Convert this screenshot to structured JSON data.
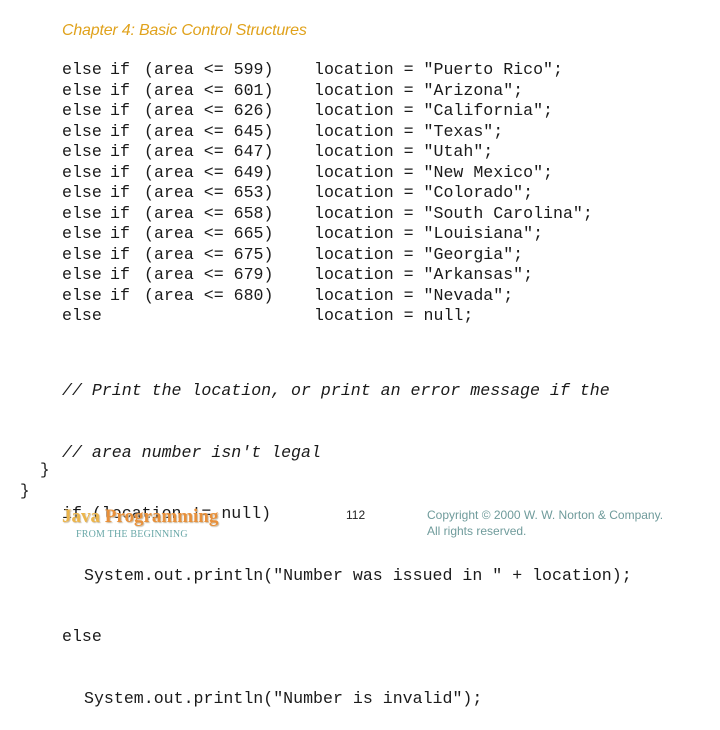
{
  "header": {
    "title": "Chapter 4: Basic Control Structures"
  },
  "code_table": {
    "rows": [
      {
        "kw1": "else",
        "kw2": "if",
        "cond": "(area <= 599)",
        "stmt": "location = \"Puerto Rico\";"
      },
      {
        "kw1": "else",
        "kw2": "if",
        "cond": "(area <= 601)",
        "stmt": "location = \"Arizona\";"
      },
      {
        "kw1": "else",
        "kw2": "if",
        "cond": "(area <= 626)",
        "stmt": "location = \"California\";"
      },
      {
        "kw1": "else",
        "kw2": "if",
        "cond": "(area <= 645)",
        "stmt": "location = \"Texas\";"
      },
      {
        "kw1": "else",
        "kw2": "if",
        "cond": "(area <= 647)",
        "stmt": "location = \"Utah\";"
      },
      {
        "kw1": "else",
        "kw2": "if",
        "cond": "(area <= 649)",
        "stmt": "location = \"New Mexico\";"
      },
      {
        "kw1": "else",
        "kw2": "if",
        "cond": "(area <= 653)",
        "stmt": "location = \"Colorado\";"
      },
      {
        "kw1": "else",
        "kw2": "if",
        "cond": "(area <= 658)",
        "stmt": "location = \"South Carolina\";"
      },
      {
        "kw1": "else",
        "kw2": "if",
        "cond": "(area <= 665)",
        "stmt": "location = \"Louisiana\";"
      },
      {
        "kw1": "else",
        "kw2": "if",
        "cond": "(area <= 675)",
        "stmt": "location = \"Georgia\";"
      },
      {
        "kw1": "else",
        "kw2": "if",
        "cond": "(area <= 679)",
        "stmt": "location = \"Arkansas\";"
      },
      {
        "kw1": "else",
        "kw2": "if",
        "cond": "(area <= 680)",
        "stmt": "location = \"Nevada\";"
      },
      {
        "kw1": "else",
        "kw2": "",
        "cond": "",
        "stmt": "location = null;"
      }
    ]
  },
  "code_tail": {
    "comment1": "// Print the location, or print an error message if the",
    "comment2": "// area number isn't legal",
    "line_if": "if (location != null)",
    "line_print1": "System.out.println(\"Number was issued in \" + location);",
    "line_else": "else",
    "line_print2": "System.out.println(\"Number is invalid\");",
    "brace_inner": "}",
    "brace_outer": "}"
  },
  "footer": {
    "brand_java": "Java",
    "brand_programming": "Programming",
    "subtitle": "FROM THE BEGINNING",
    "page_number": "112",
    "copyright_line1": "Copyright © 2000 W. W. Norton & Company.",
    "copyright_line2": "All rights reserved."
  }
}
